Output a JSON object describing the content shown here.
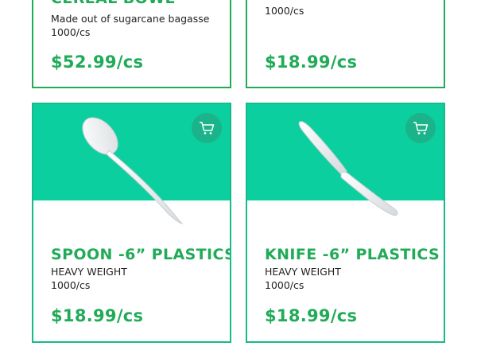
{
  "products": [
    {
      "title": "CEREAL BOWL",
      "line1": "Made out of sugarcane bagasse",
      "line2": "1000/cs",
      "price": "$52.99/cs"
    },
    {
      "title": "",
      "line1": "1000/cs",
      "line2": "",
      "price": "$18.99/cs"
    },
    {
      "title": "SPOON -6” PLASTICS",
      "line1": "HEAVY WEIGHT",
      "line2": "1000/cs",
      "price": "$18.99/cs",
      "image_icon": "plastic-spoon",
      "cart_icon": "shopping-cart-icon"
    },
    {
      "title": "KNIFE -6” PLASTICS",
      "line1": "HEAVY WEIGHT",
      "line2": "1000/cs",
      "price": "$18.99/cs",
      "image_icon": "plastic-knife",
      "cart_icon": "shopping-cart-icon"
    }
  ],
  "colors": {
    "accent_green": "#21ab58",
    "hero_teal": "#0ccfa0",
    "cart_button": "#1bb38a",
    "card_border_bottom": "#18b98a"
  }
}
